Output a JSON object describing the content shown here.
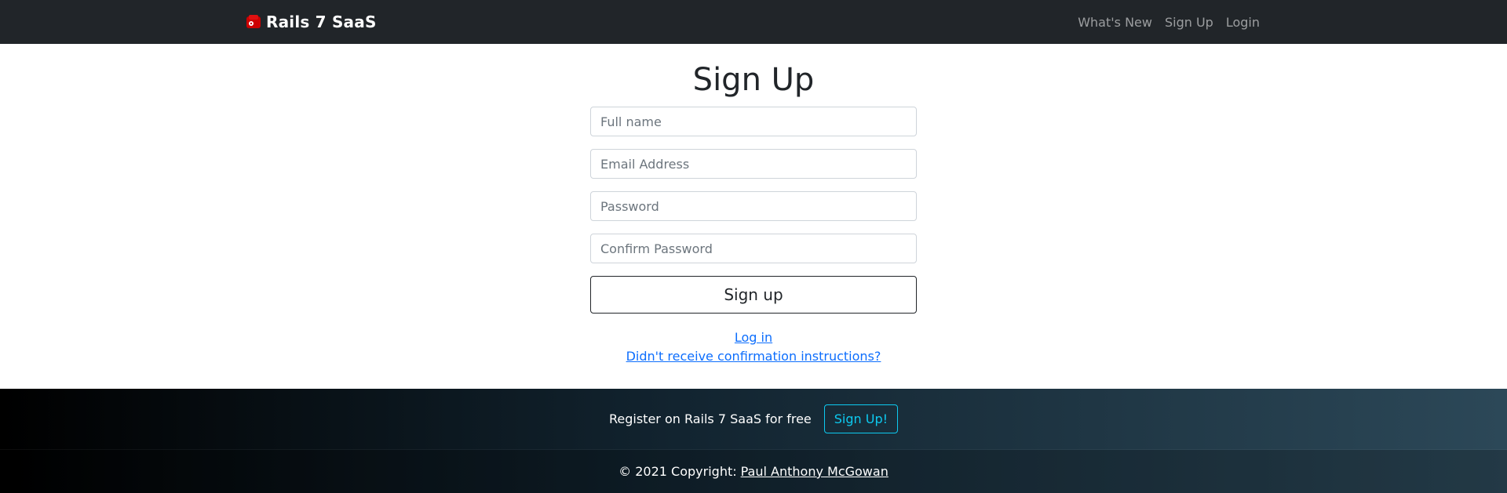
{
  "navbar": {
    "brand": "Rails 7 SaaS",
    "links": [
      "What's New",
      "Sign Up",
      "Login"
    ]
  },
  "main": {
    "title": "Sign Up",
    "fields": {
      "full_name_placeholder": "Full name",
      "email_placeholder": "Email Address",
      "password_placeholder": "Password",
      "confirm_password_placeholder": "Confirm Password"
    },
    "submit_label": "Sign up",
    "links": {
      "login": "Log in",
      "confirmation": "Didn't receive confirmation instructions?"
    }
  },
  "footer": {
    "cta_text": "Register on Rails 7 SaaS for free",
    "cta_button": "Sign Up!",
    "copyright_prefix": "© 2021 Copyright:",
    "author": "Paul Anthony McGowan"
  },
  "colors": {
    "navbar_bg": "#212529",
    "link": "#0d6efd",
    "cta_accent": "#0dcaf0",
    "logo_red": "#cc0000"
  },
  "icons": {
    "brand_logo": "rails-logo-icon"
  }
}
